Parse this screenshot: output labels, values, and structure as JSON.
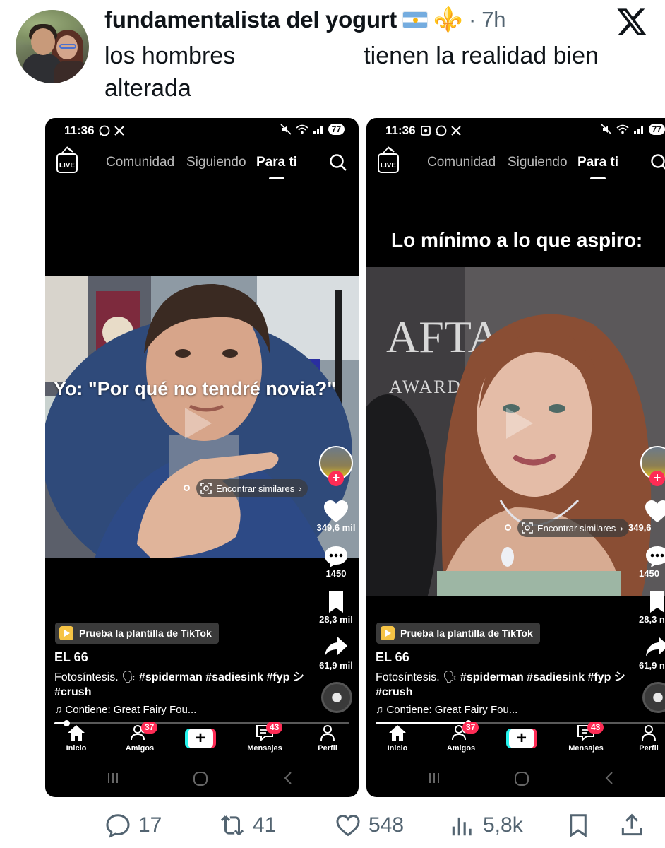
{
  "tweet": {
    "display_name": "fundamentalista del yogurt",
    "emoji_fleur": "⚜️",
    "time": "· 7h",
    "text_part1": "los hombres",
    "text_part2": "tienen la realidad bien alterada"
  },
  "phones": [
    {
      "status_time": "11:36",
      "battery": "77",
      "tabs": [
        "Comunidad",
        "Siguiendo",
        "Para ti"
      ],
      "active_tab": "Para ti",
      "caption": "Yo: \"Por qué no tendré novia?\"",
      "find_similar": "Encontrar similares",
      "likes": "349,6 mil",
      "comments": "1450",
      "saves": "28,3 mil",
      "shares": "61,9 mil",
      "template": "Prueba la plantilla de TikTok",
      "author": "EL 66",
      "desc_text": "Fotosíntesis. 🗣",
      "desc_tags": "#spiderman #sadiesink #fyp シ #crush",
      "music": "♫ Contiene: Great Fairy Fou...",
      "progress": 0.04,
      "nav": {
        "home": "Inicio",
        "friends": "Amigos",
        "friends_badge": "37",
        "messages": "Mensajes",
        "messages_badge": "43",
        "profile": "Perfil"
      }
    },
    {
      "status_time": "11:36",
      "battery": "77",
      "tabs": [
        "Comunidad",
        "Siguiendo",
        "Para ti"
      ],
      "active_tab": "Para ti",
      "caption": "Lo mínimo a lo que aspiro:",
      "find_similar": "Encontrar similares",
      "likes": "349,6",
      "comments": "1450",
      "saves": "28,3 n",
      "shares": "61,9 n",
      "template": "Prueba la plantilla de TikTok",
      "author": "EL 66",
      "desc_text": "Fotosíntesis. 🗣",
      "desc_tags": "#spiderman #sadiesink #fyp シ #crush",
      "music": "♫ Contiene: Great Fairy Fou...",
      "progress": 0.32,
      "nav": {
        "home": "Inicio",
        "friends": "Amigos",
        "friends_badge": "37",
        "messages": "Mensajes",
        "messages_badge": "43",
        "profile": "Perfil"
      }
    }
  ],
  "actions": {
    "replies": "17",
    "retweets": "41",
    "likes": "548",
    "views": "5,8k"
  },
  "colors": {
    "tiktok_red": "#fe2c55",
    "tiktok_cyan": "#25f4ee",
    "x_gray": "#536471"
  }
}
